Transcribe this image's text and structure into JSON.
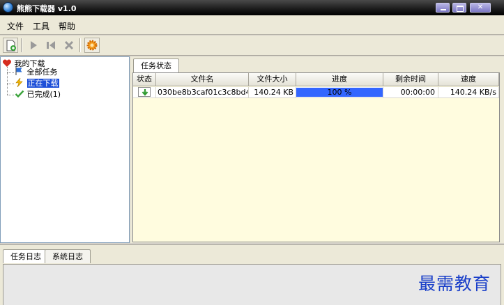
{
  "window": {
    "title": "熊熊下载器 v1.0"
  },
  "menu": [
    {
      "label": "文件"
    },
    {
      "label": "工具"
    },
    {
      "label": "帮助"
    }
  ],
  "toolbar": {
    "buttons": [
      "new-task",
      "play",
      "skip-back",
      "delete",
      "settings"
    ]
  },
  "tree": {
    "root": "我的下载",
    "items": [
      {
        "label": "全部任务"
      },
      {
        "label": "正在下载"
      },
      {
        "label": "已完成(1)"
      }
    ]
  },
  "task_tabs": [
    {
      "label": "任务状态"
    }
  ],
  "table": {
    "columns": [
      "状态",
      "文件名",
      "文件大小",
      "进度",
      "剩余时间",
      "速度"
    ],
    "rows": [
      {
        "file_name": "030be8b3caf01c3c8bd4...",
        "file_size": "140.24 KB",
        "progress_label": "100 %",
        "progress": 1.0,
        "time_left": "00:00:00",
        "speed": "140.24 KB/s"
      }
    ]
  },
  "log_tabs": [
    {
      "label": "任务日志"
    },
    {
      "label": "系统日志"
    }
  ],
  "watermark": "最需教育",
  "colors": {
    "progress": "#3366ff",
    "grid_bg": "#fffcdf",
    "selected": "#1d4fd8"
  }
}
